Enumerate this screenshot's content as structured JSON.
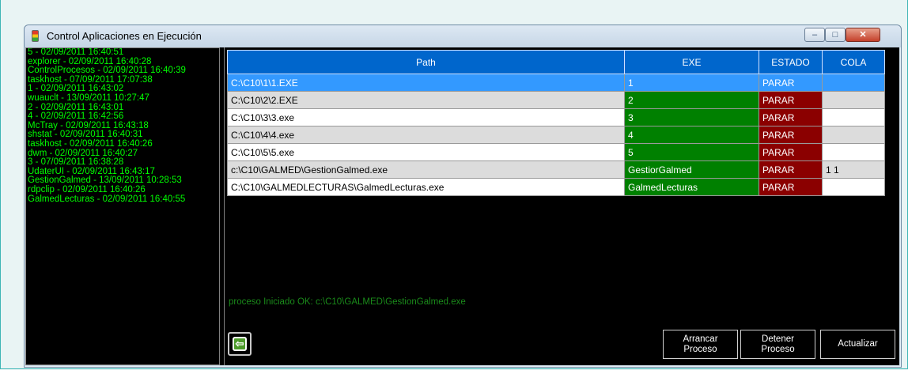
{
  "window": {
    "title": "Control Aplicaciones en Ejecución",
    "controls": {
      "minimize": "–",
      "maximize": "□",
      "close": "✕"
    }
  },
  "process_list": [
    "5 - 02/09/2011 16:40:51",
    "explorer - 02/09/2011 16:40:28",
    "ControlProcesos - 02/09/2011 16:40:39",
    "taskhost - 07/09/2011 17:07:38",
    "1 - 02/09/2011 16:43:02",
    "wuauclt - 13/09/2011 10:27:47",
    "2 - 02/09/2011 16:43:01",
    "4 - 02/09/2011 16:42:56",
    "McTray - 02/09/2011 16:43:18",
    "shstat - 02/09/2011 16:40:31",
    "taskhost - 02/09/2011 16:40:26",
    "dwm - 02/09/2011 16:40:27",
    "3 - 07/09/2011 16:38:28",
    "UdaterUI - 02/09/2011 16:43:17",
    "GestionGalmed - 13/09/2011 10:28:53",
    "rdpclip - 02/09/2011 16:40:26",
    "GalmedLecturas - 02/09/2011 16:40:55"
  ],
  "grid": {
    "headers": {
      "path": "Path",
      "exe": "EXE",
      "estado": "ESTADO",
      "cola": "COLA"
    },
    "rows": [
      {
        "path": "C:\\C10\\1\\1.EXE",
        "exe": "1",
        "estado": "PARAR",
        "cola": ""
      },
      {
        "path": "C:\\C10\\2\\2.EXE",
        "exe": "2",
        "estado": "PARAR",
        "cola": ""
      },
      {
        "path": "C:\\C10\\3\\3.exe",
        "exe": "3",
        "estado": "PARAR",
        "cola": ""
      },
      {
        "path": "C:\\C10\\4\\4.exe",
        "exe": "4",
        "estado": "PARAR",
        "cola": ""
      },
      {
        "path": "C:\\C10\\5\\5.exe",
        "exe": "5",
        "estado": "PARAR",
        "cola": ""
      },
      {
        "path": "c:\\C10\\GALMED\\GestionGalmed.exe",
        "exe": "GestiorGalmed",
        "estado": "PARAR",
        "cola": "1 1"
      },
      {
        "path": "C:\\C10\\GALMEDLECTURAS\\GalmedLecturas.exe",
        "exe": "GalmedLecturas",
        "estado": "PARAR",
        "cola": ""
      }
    ]
  },
  "status_message": "proceso Iniciado OK: c:\\C10\\GALMED\\GestionGalmed.exe",
  "buttons": {
    "exit": "⇦",
    "arrancar_line1": "Arrancar",
    "arrancar_line2": "Proceso",
    "detener_line1": "Detener",
    "detener_line2": "Proceso",
    "actualizar": "Actualizar"
  },
  "colors": {
    "header_blue": "#0066cc",
    "exe_green": "#008000",
    "estado_red": "#8b0000",
    "list_text_green": "#00ff00",
    "selection_blue": "#3399ff"
  }
}
